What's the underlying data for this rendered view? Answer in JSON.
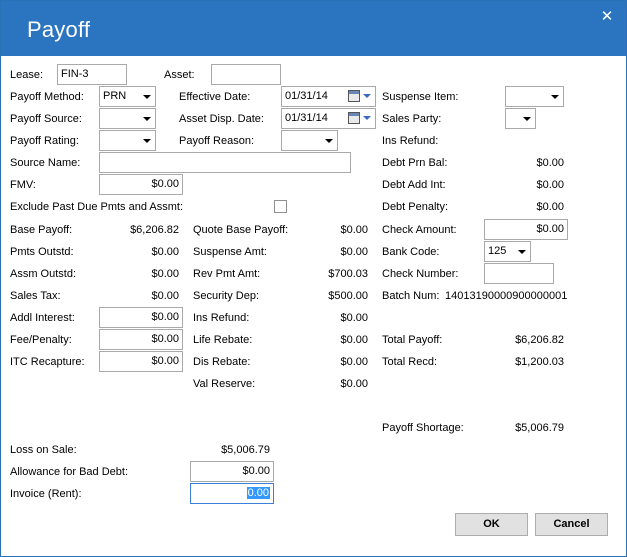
{
  "window": {
    "title": "Payoff",
    "close_glyph": "✕"
  },
  "header_row": {
    "lease_label": "Lease:",
    "lease_value": "FIN-3",
    "asset_label": "Asset:",
    "asset_value": ""
  },
  "col1": {
    "payoff_method_label": "Payoff Method:",
    "payoff_method_value": "PRN",
    "payoff_source_label": "Payoff Source:",
    "payoff_source_value": "",
    "payoff_rating_label": "Payoff Rating:",
    "payoff_rating_value": "",
    "source_name_label": "Source Name:",
    "source_name_value": "",
    "fmv_label": "FMV:",
    "fmv_value": "$0.00",
    "exclude_label": "Exclude Past Due Pmts and Assmt:",
    "base_payoff_label": "Base Payoff:",
    "base_payoff_value": "$6,206.82",
    "pmts_outstd_label": "Pmts Outstd:",
    "pmts_outstd_value": "$0.00",
    "assm_outstd_label": "Assm Outstd:",
    "assm_outstd_value": "$0.00",
    "sales_tax_label": "Sales Tax:",
    "sales_tax_value": "$0.00",
    "addl_interest_label": "Addl Interest:",
    "addl_interest_value": "$0.00",
    "fee_penalty_label": "Fee/Penalty:",
    "fee_penalty_value": "$0.00",
    "itc_recapture_label": "ITC Recapture:",
    "itc_recapture_value": "$0.00"
  },
  "col2": {
    "effective_date_label": "Effective Date:",
    "effective_date_value": "01/31/14",
    "asset_disp_date_label": "Asset Disp. Date:",
    "asset_disp_date_value": "01/31/14",
    "payoff_reason_label": "Payoff Reason:",
    "payoff_reason_value": "",
    "quote_base_payoff_label": "Quote Base Payoff:",
    "quote_base_payoff_value": "$0.00",
    "suspense_amt_label": "Suspense Amt:",
    "suspense_amt_value": "$0.00",
    "rev_pmt_amt_label": "Rev Pmt Amt:",
    "rev_pmt_amt_value": "$700.03",
    "security_dep_label": "Security Dep:",
    "security_dep_value": "$500.00",
    "ins_refund_label": "Ins Refund:",
    "ins_refund_value": "$0.00",
    "life_rebate_label": "Life Rebate:",
    "life_rebate_value": "$0.00",
    "dis_rebate_label": "Dis Rebate:",
    "dis_rebate_value": "$0.00",
    "val_reserve_label": "Val Reserve:",
    "val_reserve_value": "$0.00"
  },
  "col3": {
    "suspense_item_label": "Suspense Item:",
    "suspense_item_value": "",
    "sales_party_label": "Sales Party:",
    "sales_party_value": "",
    "ins_refund_label": "Ins Refund:",
    "debt_prn_bal_label": "Debt Prn Bal:",
    "debt_prn_bal_value": "$0.00",
    "debt_add_int_label": "Debt Add Int:",
    "debt_add_int_value": "$0.00",
    "debt_penalty_label": "Debt Penalty:",
    "debt_penalty_value": "$0.00",
    "check_amount_label": "Check Amount:",
    "check_amount_value": "$0.00",
    "bank_code_label": "Bank Code:",
    "bank_code_value": "125",
    "check_number_label": "Check Number:",
    "check_number_value": "",
    "batch_num_label": "Batch Num:",
    "batch_num_value": "14013190000900000001",
    "total_payoff_label": "Total Payoff:",
    "total_payoff_value": "$6,206.82",
    "total_recd_label": "Total Recd:",
    "total_recd_value": "$1,200.03",
    "payoff_shortage_label": "Payoff Shortage:",
    "payoff_shortage_value": "$5,006.79"
  },
  "bottom": {
    "loss_on_sale_label": "Loss on Sale:",
    "loss_on_sale_value": "$5,006.79",
    "allowance_label": "Allowance for Bad Debt:",
    "allowance_value": "$0.00",
    "invoice_label": "Invoice (Rent):",
    "invoice_value": "0.00"
  },
  "buttons": {
    "ok_label": "OK",
    "cancel_label": "Cancel"
  }
}
